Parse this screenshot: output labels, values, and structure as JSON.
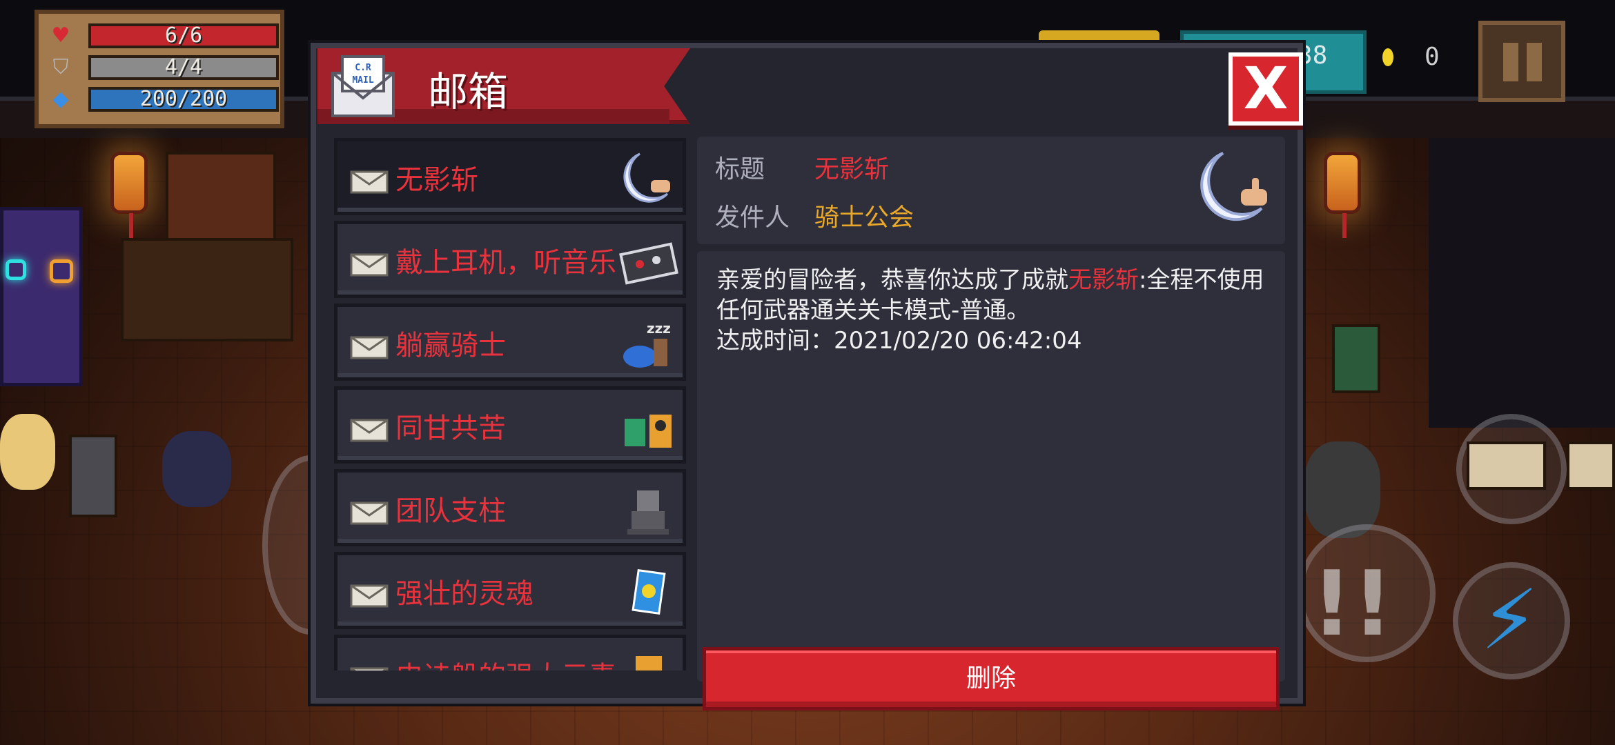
{
  "hud": {
    "hp": "6/6",
    "armor": "4/4",
    "energy": "200/200",
    "gems_partial": "38",
    "coins": "0"
  },
  "mailbox": {
    "title": "邮箱",
    "mail_icon_text": "C.R MAIL",
    "close_label": "X",
    "items": [
      {
        "name": "无影斩"
      },
      {
        "name": "戴上耳机，听音乐"
      },
      {
        "name": "躺赢骑士"
      },
      {
        "name": "同甘共苦"
      },
      {
        "name": "团队支柱"
      },
      {
        "name": "强壮的灵魂"
      },
      {
        "name": "史诗般的强大元素"
      }
    ],
    "detail": {
      "title_label": "标题",
      "title_value": "无影斩",
      "sender_label": "发件人",
      "sender_value": "骑士公会",
      "body_part1": "亲爱的冒险者，恭喜你达成了成就",
      "body_highlight": "无影斩",
      "body_part2": ":全程不使用任何武器通关关卡模式-普通。",
      "achieved_label": "达成时间：",
      "achieved_time": "2021/02/20 06:42:04",
      "delete_label": "删除"
    }
  },
  "colors": {
    "accent_red": "#e8323c",
    "sender_gold": "#e9a82a",
    "panel": "#2e2f3b",
    "ribbon": "#a3212a"
  }
}
